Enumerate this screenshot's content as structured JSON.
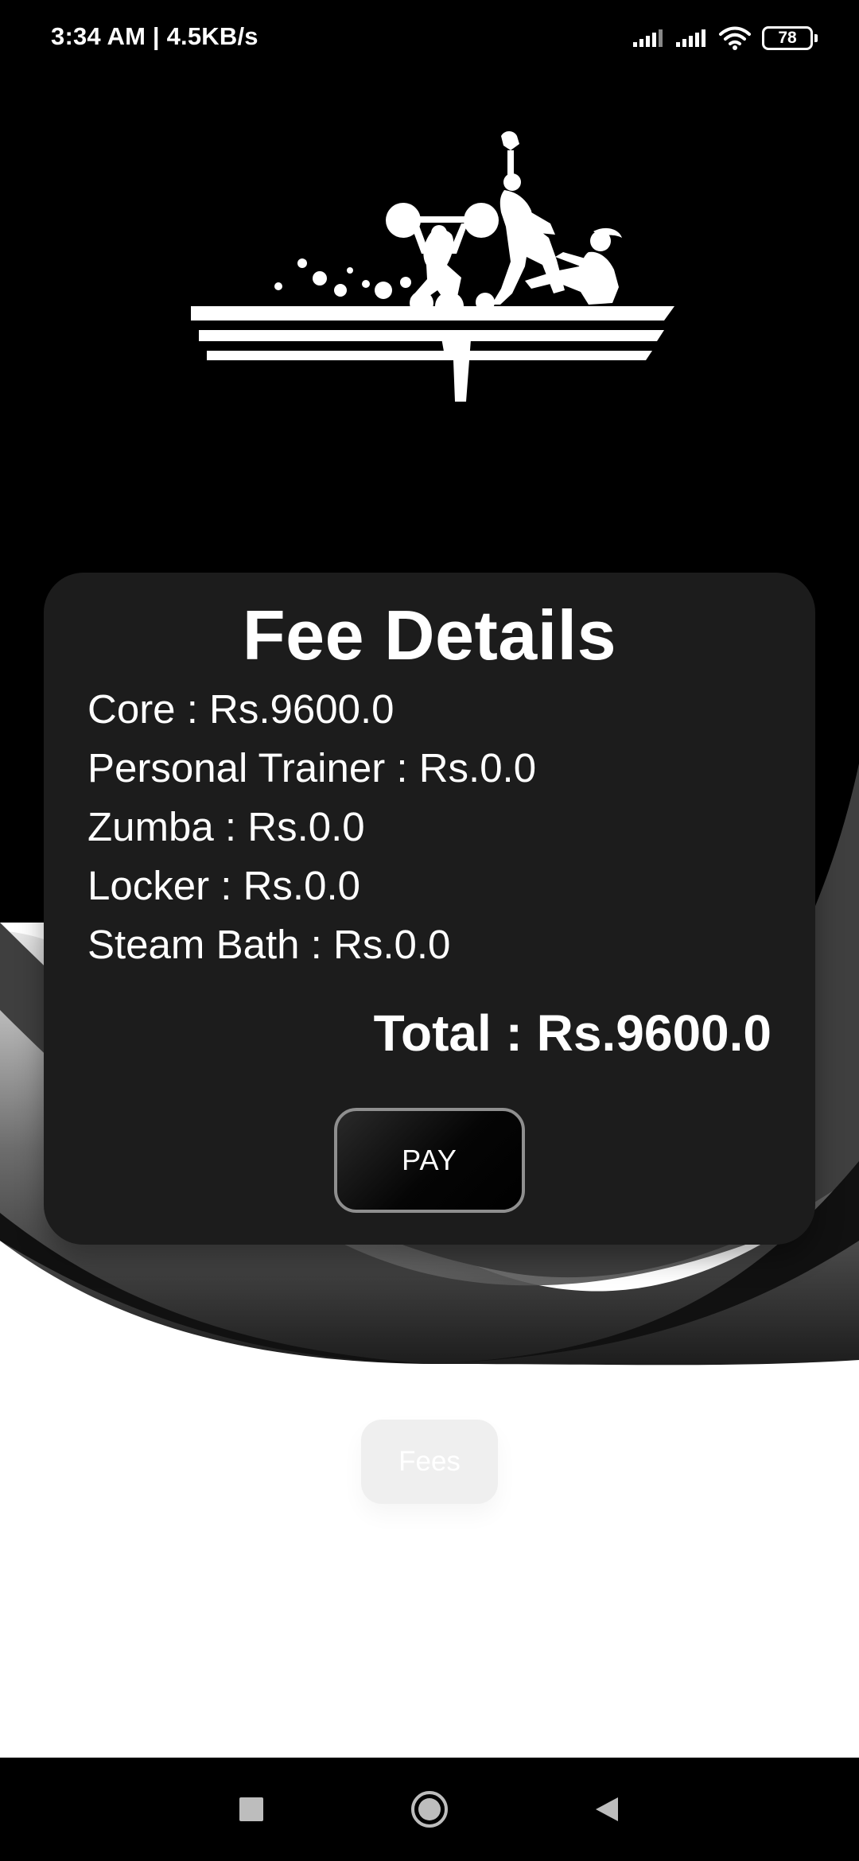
{
  "status_bar": {
    "time_speed": "3:34 AM | 4.5KB/s",
    "battery": "78"
  },
  "fee_card": {
    "title": "Fee Details",
    "items": [
      "Core : Rs.9600.0",
      "Personal Trainer : Rs.0.0",
      "Zumba : Rs.0.0",
      "Locker : Rs.0.0",
      "Steam Bath : Rs.0.0"
    ],
    "total": "Total : Rs.9600.0",
    "pay_label": "PAY"
  },
  "fees_button_label": "Fees",
  "nav_bar": {
    "recents_icon": "square-icon",
    "home_icon": "circle-icon",
    "back_icon": "triangle-back-icon"
  },
  "colors": {
    "background_top": "#000000",
    "card_background": "#1c1c1c",
    "text": "#ffffff",
    "page_background": "#ffffff"
  }
}
